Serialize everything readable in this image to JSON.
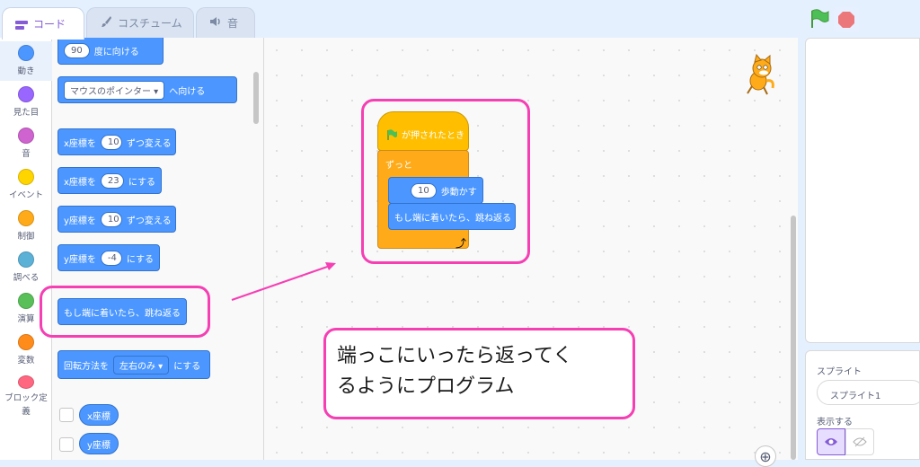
{
  "tabs": [
    {
      "label": "コード",
      "icon": "code-icon"
    },
    {
      "label": "コスチューム",
      "icon": "brush-icon"
    },
    {
      "label": "音",
      "icon": "speaker-icon"
    }
  ],
  "categories": [
    {
      "label": "動き",
      "color": "#4c97ff"
    },
    {
      "label": "見た目",
      "color": "#9966ff"
    },
    {
      "label": "音",
      "color": "#cf63cf"
    },
    {
      "label": "イベント",
      "color": "#ffd500"
    },
    {
      "label": "制御",
      "color": "#ffab19"
    },
    {
      "label": "調べる",
      "color": "#5cb1d6"
    },
    {
      "label": "演算",
      "color": "#59c059"
    },
    {
      "label": "変数",
      "color": "#ff8c1a"
    },
    {
      "label": "ブロック定義",
      "color": "#ff6680"
    }
  ],
  "palette": {
    "point_dir": {
      "value": "90",
      "label": "度に向ける"
    },
    "point_towards": {
      "dropdown": "マウスのポインター",
      "label": "へ向ける"
    },
    "change_x": {
      "prefix": "x座標を",
      "value": "10",
      "label": "ずつ変える"
    },
    "set_x": {
      "prefix": "x座標を",
      "value": "23",
      "label": "にする"
    },
    "change_y": {
      "prefix": "y座標を",
      "value": "10",
      "label": "ずつ変える"
    },
    "set_y": {
      "prefix": "y座標を",
      "value": "-4",
      "label": "にする"
    },
    "bounce": "もし端に着いたら、跳ね返る",
    "rotation": {
      "prefix": "回転方法を",
      "dropdown": "左右のみ",
      "label": "にする"
    },
    "x_reporter": "x座標",
    "y_reporter": "y座標"
  },
  "script": {
    "hat_label": "が押されたとき",
    "forever_label": "ずっと",
    "move_value": "10",
    "move_label": "歩動かす",
    "bounce_label": "もし端に着いたら、跳ね返る"
  },
  "note": {
    "line1": "端っこにいったら返ってく",
    "line2": "るようにプログラム"
  },
  "sprite_panel": {
    "title": "スプライト",
    "name": "スプライト1",
    "show_label": "表示する"
  },
  "accent": "#f53fb3"
}
